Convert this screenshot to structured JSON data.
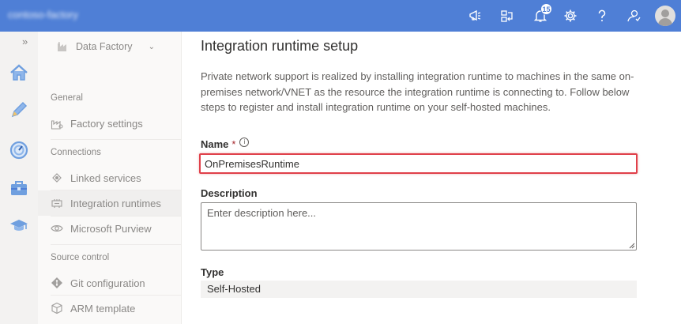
{
  "topbar": {
    "brand": "contoso-factory",
    "notifications_count": "15",
    "icons": [
      "megaphone-icon",
      "switch-directory-icon",
      "bell-icon",
      "gear-icon",
      "help-icon",
      "feedback-icon",
      "avatar"
    ]
  },
  "rail": {
    "items": [
      "home-icon",
      "author-pencil-icon",
      "monitor-gauge-icon",
      "manage-toolbox-icon",
      "learning-center-icon"
    ]
  },
  "nav": {
    "collapse": "»",
    "factory_label": "Data Factory",
    "sections": {
      "general": "General",
      "connections": "Connections",
      "source_control": "Source control"
    },
    "items": {
      "factory_settings": "Factory settings",
      "linked_services": "Linked services",
      "integration_runtimes": "Integration runtimes",
      "purview": "Microsoft Purview",
      "git_configuration": "Git configuration",
      "arm_template": "ARM template"
    }
  },
  "panel": {
    "title": "Integration runtime setup",
    "description": "Private network support is realized by installing integration runtime to machines in the same on-premises network/VNET as the resource the integration runtime is connecting to. Follow below steps to register and install integration runtime on your self-hosted machines.",
    "name_label": "Name",
    "required_mark": "*",
    "info_glyph": "i",
    "name_value": "OnPremisesRuntime",
    "description_label": "Description",
    "description_placeholder": "Enter description here...",
    "type_label": "Type",
    "type_value": "Self-Hosted"
  },
  "colors": {
    "topbar": "#4f7fd6",
    "highlight": "#e0404a",
    "rail_icon": "#6f9fdf"
  }
}
